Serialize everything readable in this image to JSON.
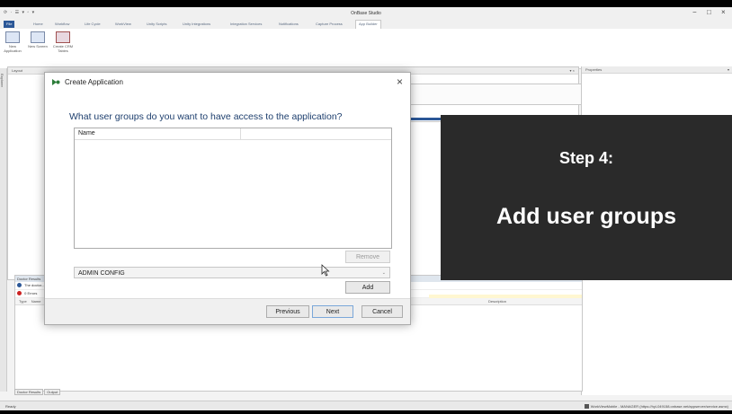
{
  "window": {
    "title": "OnBase Studio",
    "quick_access": "⟳ · ☰ ▾ ▫ ▾",
    "minimize": "−",
    "maximize": "□",
    "close": "×"
  },
  "ribbon": {
    "tabs": [
      "File",
      "Home",
      "Workflow",
      "Life Cycle",
      "WorkView",
      "Unity Scripts",
      "Unity Integrations",
      "Integration Services",
      "Notifications",
      "Capture Process",
      "App Builder"
    ],
    "active_tab": "App Builder",
    "buttons": [
      {
        "label": "New Application",
        "icon": "new-application-icon"
      },
      {
        "label": "New Screen",
        "icon": "new-screen-icon"
      },
      {
        "label": "Create CRM Tables",
        "icon": "create-crm-tables-icon"
      }
    ]
  },
  "side_strip": {
    "label": "Explorer"
  },
  "layout_panel": {
    "title": "Layout",
    "pin": "▾ × "
  },
  "properties_panel": {
    "title": "Properties",
    "dropdown": "▾"
  },
  "doctor": {
    "title": "Doctor Results",
    "rows": [
      {
        "text": "The doctor...",
        "color": "#2b5797"
      },
      {
        "text": "0 Errors",
        "color": "#cc2222"
      }
    ],
    "columns": [
      "Type",
      "Name",
      "Description"
    ]
  },
  "bottom_tabs": [
    "Doctor Results",
    "Output"
  ],
  "status": {
    "ready": "Ready",
    "connection": "WorkViewMobile - MANAGER (https://hyl-049158.onbase.net/appserver/service.asmx)"
  },
  "dialog": {
    "title": "Create Application",
    "close": "×",
    "question": "What user groups do you want to have access to the application?",
    "grid_header": "Name",
    "remove_label": "Remove",
    "combo_value": "ADMIN CONFIG",
    "combo_arrow": "⌄",
    "add_label": "Add",
    "previous_label": "Previous",
    "next_label": "Next",
    "cancel_label": "Cancel"
  },
  "overlay": {
    "step": "Step 4:",
    "text": "Add user groups"
  }
}
